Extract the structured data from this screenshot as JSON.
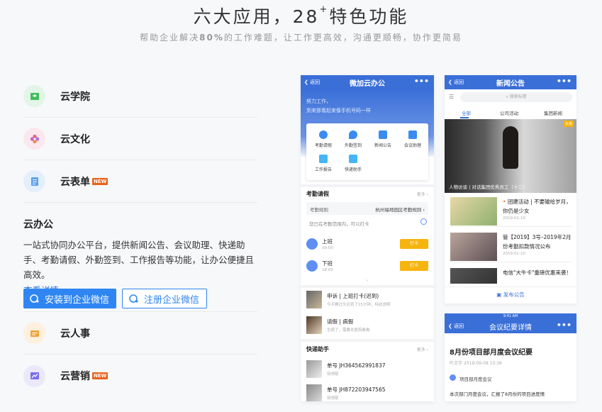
{
  "hero": {
    "title_main": "六大应用，28",
    "title_sup": "+",
    "title_rest": "特色功能",
    "subtitle_pre": "帮助企业解决",
    "subtitle_num": "80%",
    "subtitle_post": "的工作难题，让工作更高效，沟通更顺畅，协作更简易"
  },
  "apps": [
    {
      "name": "云学院",
      "icon": "graduation-cap-icon",
      "color": "#3fbf5a"
    },
    {
      "name": "云文化",
      "icon": "flower-icon",
      "color": "#e8608c"
    },
    {
      "name": "云表单",
      "icon": "form-icon",
      "color": "#5aa0f2",
      "badge": "NEW"
    },
    {
      "name": "云人事",
      "icon": "id-card-icon",
      "color": "#f0a43a"
    },
    {
      "name": "云营销",
      "icon": "chart-icon",
      "color": "#7b6cf0",
      "badge": "NEW"
    }
  ],
  "expanded": {
    "title": "云办公",
    "desc": "一站式协同办公平台，提供新闻公告、会议助理、快递助手、考勤请假、外勤签到、工作报告等功能，让办公便捷且高效。",
    "link": "查看详情",
    "link_arrow": "›",
    "btn_install": "安装到企业微信",
    "btn_register": "注册企业微信"
  },
  "phone1": {
    "back": "返回",
    "title": "微加云办公",
    "more": "•••",
    "greet1": "努力工作，",
    "greet2": "到来那看起来像手机号码一样",
    "grid": [
      "考勤请假",
      "外勤签到",
      "新闻公告",
      "会议助理",
      "工作报告",
      "快递助手"
    ],
    "sec1": "考勤请假",
    "sec1_more": "更多 ›",
    "rule_label": "考勤规则",
    "rule_value": "杭州福地园区考勤规则 ›",
    "range": "您已在考勤范围内，可以打卡",
    "on": "上班",
    "on_time": "09:00",
    "off": "下班",
    "off_time": "18:00",
    "punch": "打卡",
    "req1": "申诉 | 上班打卡(迟到)",
    "req1_sub": "今天睡过头迟到了15分钟，特此说明",
    "req2": "请假 | 病假",
    "req2_sub": "生病了，需要去医院看看",
    "sec2": "快递助手",
    "sec2_more": "更多 ›",
    "ship1": "单号 JH364562991837",
    "ship1_sub": "待领取",
    "ship2": "单号 JH872203947565",
    "ship2_sub": "待领取"
  },
  "phone2": {
    "back": "返回",
    "title": "新闻公告",
    "more": "•••",
    "search": "搜索标题",
    "tabs": [
      "全部",
      "公司活动",
      "集团新闻"
    ],
    "hero_caption": "人物访谈 | 对话集团优秀员工（十二）",
    "badge": "头条",
    "news": [
      {
        "text": "团建活动 | 不要输给岁月，你仍是少女",
        "date": "2019-01-10"
      },
      {
        "text": "管【2019】3号–2019年2月份考勤扣款情况公布",
        "date": "2019-01-10"
      },
      {
        "text": "电信\"大牛卡\"重磅优惠来袭！",
        "date": ""
      }
    ],
    "publish": "发布公告"
  },
  "phone3": {
    "time": "9:41 AM",
    "back": "返回",
    "title": "会议纪要详情",
    "more": "•••",
    "heading": "8月份项目部月度会议纪要",
    "meta": "叶文宇  2019-09-08 10:36",
    "dept": "项目部月度会议",
    "body": "本次部门月度会议，汇报了8月份的项目进度情"
  }
}
